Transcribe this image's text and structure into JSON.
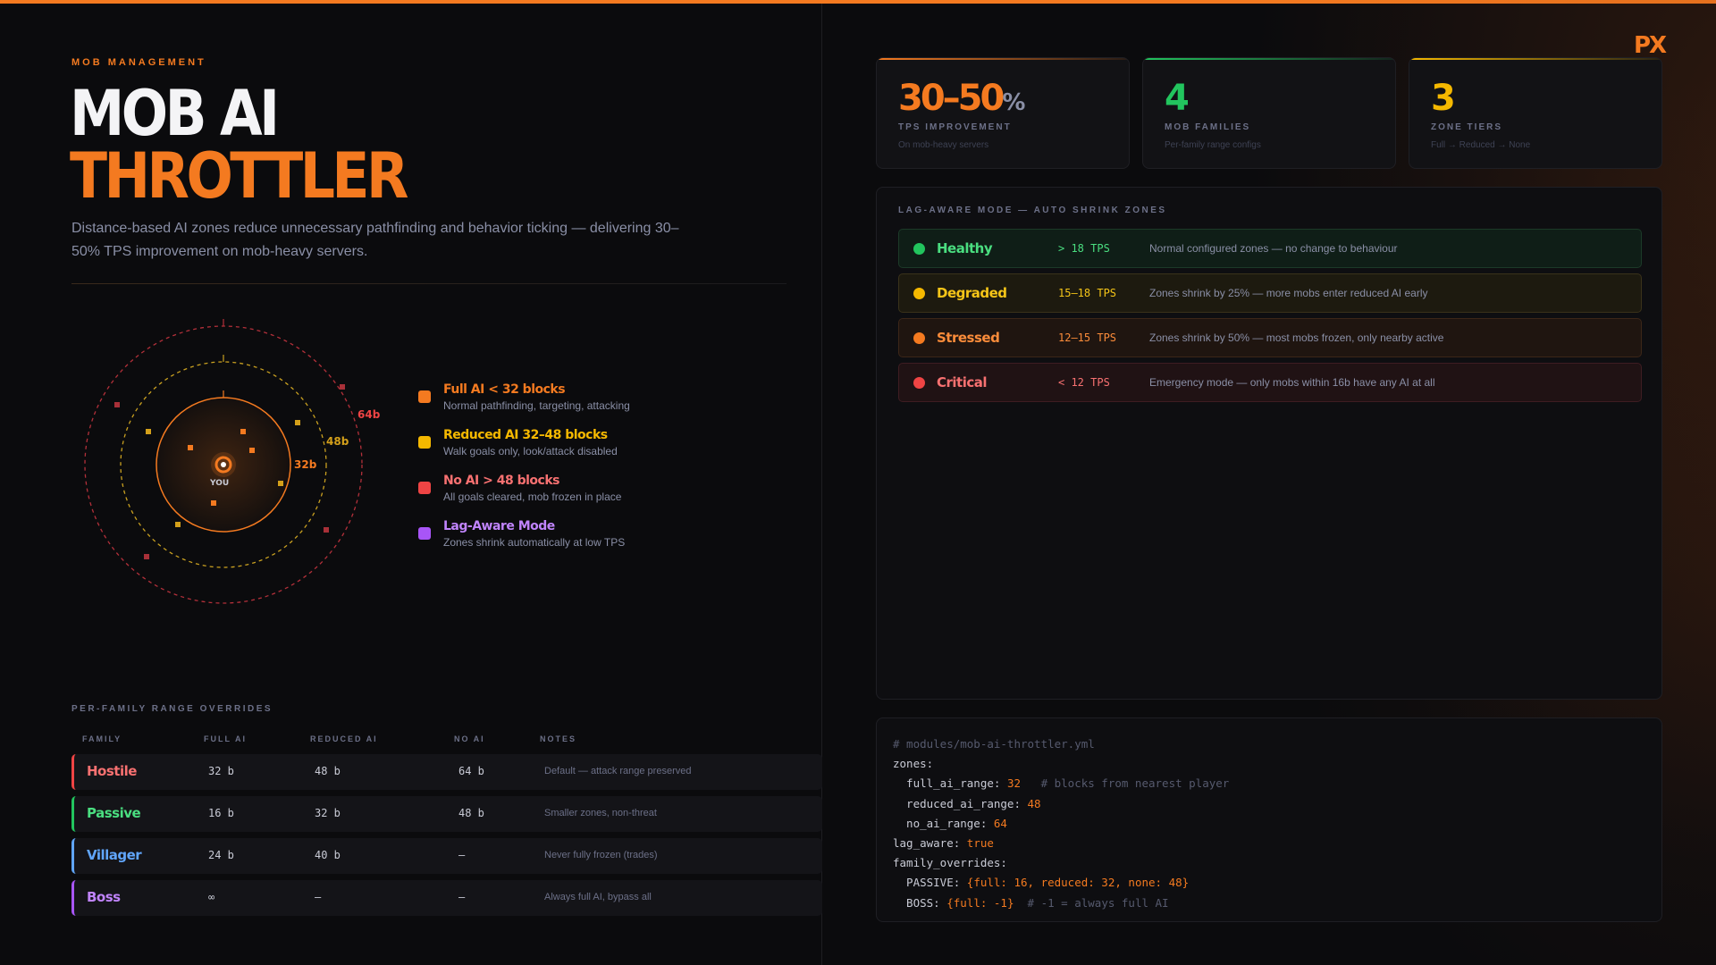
{
  "header": {
    "eyebrow": "MOB MANAGEMENT",
    "title_line1": "MOB AI",
    "title_line2": "THROTTLER",
    "description": "Distance-based AI zones reduce unnecessary pathfinding and behavior ticking — delivering 30–50% TPS improvement on mob-heavy servers."
  },
  "radar": {
    "center_label": "YOU",
    "ring_labels": [
      "32b",
      "48b",
      "64b"
    ]
  },
  "legend": [
    {
      "title": "Full AI < 32 blocks",
      "sub": "Normal pathfinding, targeting, attacking",
      "color": "#f47a20"
    },
    {
      "title": "Reduced AI 32–48 blocks",
      "sub": "Walk goals only, look/attack disabled",
      "color": "#f5b800"
    },
    {
      "title": "No AI > 48 blocks",
      "sub": "All goals cleared, mob frozen in place",
      "color": "#ef4444"
    },
    {
      "title": "Lag-Aware Mode",
      "sub": "Zones shrink automatically at low TPS",
      "color": "#a855f7"
    }
  ],
  "overrides": {
    "section_label": "PER-FAMILY RANGE OVERRIDES",
    "columns": [
      "FAMILY",
      "FULL AI",
      "REDUCED AI",
      "NO AI",
      "NOTES"
    ],
    "rows": [
      {
        "family": "Hostile",
        "full": "32 b",
        "reduced": "48 b",
        "none": "64 b",
        "notes": "Default — attack range preserved",
        "color": "#ef4444"
      },
      {
        "family": "Passive",
        "full": "16 b",
        "reduced": "32 b",
        "none": "48 b",
        "notes": "Smaller zones, non-threat",
        "color": "#22c55e"
      },
      {
        "family": "Villager",
        "full": "24 b",
        "reduced": "40 b",
        "none": "—",
        "notes": "Never fully frozen (trades)",
        "color": "#60a5fa"
      },
      {
        "family": "Boss",
        "full": "∞",
        "reduced": "—",
        "none": "—",
        "notes": "Always full AI, bypass all",
        "color": "#a855f7"
      }
    ]
  },
  "stats": [
    {
      "value": "30–50",
      "suffix": "%",
      "label": "TPS IMPROVEMENT",
      "sub": "On mob-heavy servers",
      "color": "#f47a20"
    },
    {
      "value": "4",
      "suffix": "",
      "label": "MOB FAMILIES",
      "sub": "Per-family range configs",
      "color": "#22c55e"
    },
    {
      "value": "3",
      "suffix": "",
      "label": "ZONE TIERS",
      "sub": "Full → Reduced → None",
      "color": "#f5b800"
    }
  ],
  "brand": "PX",
  "lag_aware": {
    "title": "LAG-AWARE MODE — AUTO SHRINK ZONES",
    "rows": [
      {
        "name": "Healthy",
        "tps": "> 18 TPS",
        "desc": "Normal configured zones — no change to behaviour",
        "color": "#22c55e"
      },
      {
        "name": "Degraded",
        "tps": "15–18 TPS",
        "desc": "Zones shrink by 25% — more mobs enter reduced AI early",
        "color": "#f5b800"
      },
      {
        "name": "Stressed",
        "tps": "12–15 TPS",
        "desc": "Zones shrink by 50% — most mobs frozen, only nearby active",
        "color": "#f47a20"
      },
      {
        "name": "Critical",
        "tps": "< 12 TPS",
        "desc": "Emergency mode — only mobs within 16b have any AI at all",
        "color": "#ef4444"
      }
    ]
  },
  "code": {
    "comment_path": "# modules/mob-ai-throttler.yml",
    "zones_key": "zones:",
    "full_key": "  full_ai_range: ",
    "full_val": "32",
    "full_comment": "   # blocks from nearest player",
    "reduced_key": "  reduced_ai_range: ",
    "reduced_val": "48",
    "none_key": "  no_ai_range: ",
    "none_val": "64",
    "lag_key": "lag_aware: ",
    "lag_val": "true",
    "fam_key": "family_overrides:",
    "passive_key": "  PASSIVE: ",
    "passive_val": "{full: 16, reduced: 32, none: 48}",
    "boss_key": "  BOSS: ",
    "boss_val": "{full: -1}",
    "boss_comment": "  # -1 = always full AI"
  }
}
